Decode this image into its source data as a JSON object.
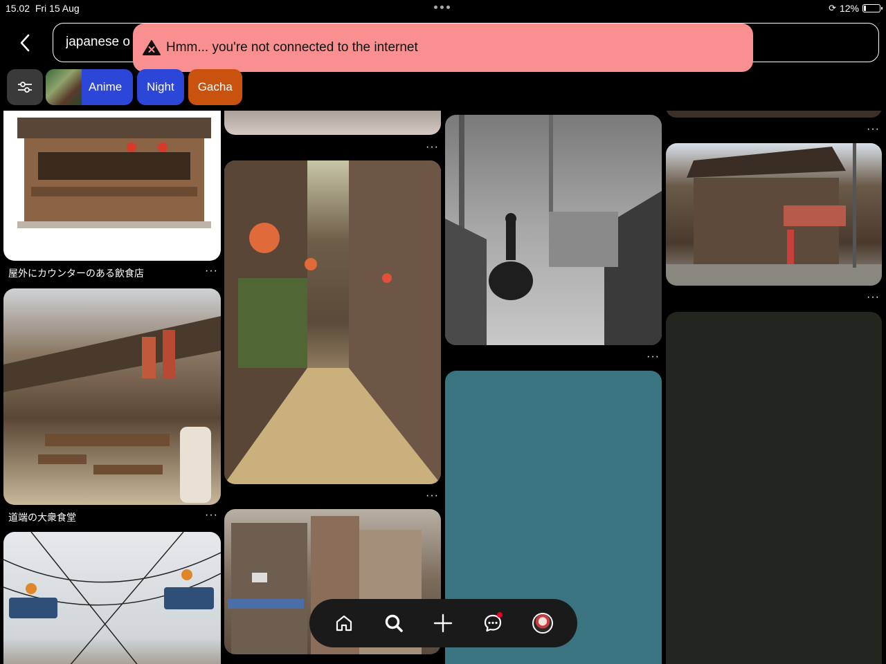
{
  "status": {
    "time": "15.02",
    "date": "Fri 15 Aug",
    "battery": "12%"
  },
  "search": {
    "query": "japanese o"
  },
  "toast": {
    "message": "Hmm... you're not connected to the internet"
  },
  "filters": {
    "chips": [
      {
        "label": "Anime"
      },
      {
        "label": "Night"
      },
      {
        "label": "Gacha"
      }
    ]
  },
  "pins": [
    {
      "caption": "屋外にカウンターのある飲食店"
    },
    {
      "caption": "道端の大衆食堂"
    }
  ],
  "overflow_symbol": "···",
  "colors": {
    "toast_bg": "#f98f8f",
    "chip_blue": "#2c46d8",
    "chip_orange": "#c8520e",
    "teal_pin": "#3a7480",
    "dark_pin": "#23251f"
  }
}
